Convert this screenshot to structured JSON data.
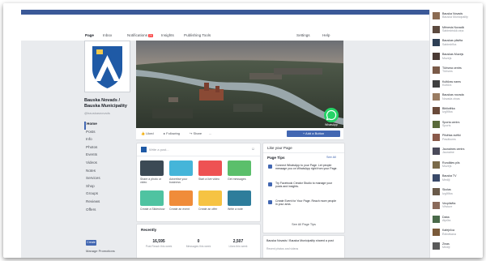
{
  "nav": {
    "links": [
      "Page",
      "Inbox",
      "Notifications",
      "Insights",
      "Publishing Tools"
    ],
    "notifications_badge": "20",
    "right": [
      "Settings",
      "Help"
    ]
  },
  "page": {
    "name": "Bauska Novads / Bauska Municipality",
    "handle": "@bauskasnovads"
  },
  "sidebar": {
    "items": [
      "Home",
      "Posts",
      "Info",
      "Photos",
      "Events",
      "Videos",
      "Notes",
      "Services",
      "Shop",
      "Groups",
      "Reviews",
      "Offers"
    ],
    "create_label": "Create",
    "footer": "Manage Promotions"
  },
  "cover": {
    "whatsapp_label": "WhatsApp"
  },
  "actions": {
    "liked": "Liked",
    "following": "Following",
    "share": "Share",
    "more": "...",
    "contact": "+ Add a Button"
  },
  "composer": {
    "placeholder": "Write a post...",
    "tiles": [
      {
        "label": "Share a photo or video",
        "color": "#3c4a55"
      },
      {
        "label": "Advertise your business",
        "color": "#45b5d9"
      },
      {
        "label": "Start a live video",
        "color": "#ee5253"
      },
      {
        "label": "Get messages",
        "color": "#5bbf6b"
      },
      {
        "label": "Create a Slideshow",
        "color": "#4fc3a1"
      },
      {
        "label": "Create an event",
        "color": "#f08c3a"
      },
      {
        "label": "Create an offer",
        "color": "#f6c343"
      },
      {
        "label": "Write a note",
        "color": "#2e7d9b"
      }
    ]
  },
  "recently": {
    "title": "Recently",
    "stats": [
      {
        "value": "16,595",
        "label": "Post Reach this week"
      },
      {
        "value": "0",
        "label": "Messages this week"
      },
      {
        "value": "2,507",
        "label": "Likes this week"
      }
    ]
  },
  "tips": {
    "header": "Like your Page",
    "title": "Page Tips",
    "see_all": "See All",
    "rows": [
      {
        "text": "Connect WhatsApp to your Page. Let people message you on WhatsApp right from your Page.",
        "link": "Connect"
      },
      {
        "text": "Try Facebook Creator Studio to manage your posts and insights.",
        "link": "Try it"
      },
      {
        "text": "Create Event for Your Page. Reach more people in your area.",
        "link": "Create"
      }
    ],
    "see_all_tips": "See All Page Tips"
  },
  "post_box": {
    "text": "Bauska Novads / Bauska Municipality shared a post",
    "subtext": "Recent photos and videos"
  },
  "right_column": [
    {
      "title": "Bauska Novads",
      "sub": "Bauska Municipality",
      "color": "#8b6b52"
    },
    {
      "title": "Mēnesis Novadā",
      "sub": "Sabiedriskā ziņa",
      "color": "#5c4a3f"
    },
    {
      "title": "Bauskas pilsēta",
      "sub": "Sabiedrība",
      "color": "#2e3f55"
    },
    {
      "title": "Bauskas Muzejs",
      "sub": "Muzejs",
      "color": "#4a3a34"
    },
    {
      "title": "Tūrisma centrs",
      "sub": "Tūrisms",
      "color": "#7a5a48"
    },
    {
      "title": "Kultūras nams",
      "sub": "Kultūra",
      "color": "#3f3f3f"
    },
    {
      "title": "Bauskas novada",
      "sub": "Novada ziņas",
      "color": "#9a7c62"
    },
    {
      "title": "Bibliotēka",
      "sub": "Izglītība",
      "color": "#6a4a3a"
    },
    {
      "title": "Sporta centrs",
      "sub": "Sports",
      "color": "#5a6a3a"
    },
    {
      "title": "Pilsētas svētki",
      "sub": "Pasākums",
      "color": "#8a5a4a"
    },
    {
      "title": "Jaunatnes centrs",
      "sub": "Jaunatne",
      "color": "#4a4a5a"
    },
    {
      "title": "Rundāles pils",
      "sub": "Muzejs",
      "color": "#7a6a4a"
    },
    {
      "title": "Bauska TV",
      "sub": "Mediji",
      "color": "#3a4a6a"
    },
    {
      "title": "Skolas",
      "sub": "Izglītība",
      "color": "#6a5a4a"
    },
    {
      "title": "Vecpilsēta",
      "sub": "Vēsture",
      "color": "#8a6a5a"
    },
    {
      "title": "Daba",
      "sub": "Atpūta",
      "color": "#4a6a4a"
    },
    {
      "title": "Kafejnīca",
      "sub": "Ēdināšana",
      "color": "#7a5a3a"
    },
    {
      "title": "Ziņas",
      "sub": "Mediji",
      "color": "#5a5a5a"
    }
  ]
}
